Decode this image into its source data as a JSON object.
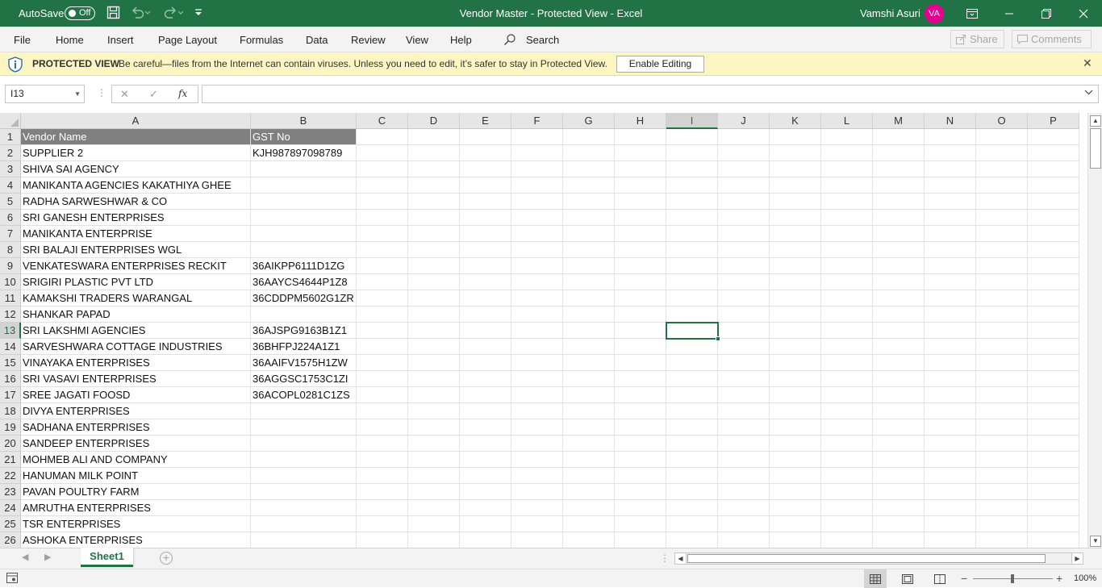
{
  "titlebar": {
    "autosave_label": "AutoSave",
    "autosave_state": "Off",
    "doc_title": "Vendor Master  -  Protected View  -  Excel",
    "user_name": "Vamshi Asuri",
    "user_initials": "VA",
    "colors": {
      "bar": "#217346",
      "avatar": "#e3008c"
    }
  },
  "menu": {
    "items": [
      "File",
      "Home",
      "Insert",
      "Page Layout",
      "Formulas",
      "Data",
      "Review",
      "View",
      "Help"
    ],
    "search_label": "Search",
    "share_label": "Share",
    "comments_label": "Comments"
  },
  "protected_view": {
    "title": "PROTECTED VIEW",
    "message": "Be careful—files from the Internet can contain viruses. Unless you need to edit, it’s safer to stay in Protected View.",
    "enable_button": "Enable Editing",
    "close_glyph": "✕",
    "colors": {
      "bar": "#fdf6c3"
    }
  },
  "formula_bar": {
    "name_box": "I13",
    "cancel_glyph": "✕",
    "enter_glyph": "✓",
    "fx_label": "fx",
    "formula": ""
  },
  "sheet": {
    "columns": [
      "A",
      "B",
      "C",
      "D",
      "E",
      "F",
      "G",
      "H",
      "I",
      "J",
      "K",
      "L",
      "M",
      "N",
      "O",
      "P"
    ],
    "selected_column": "I",
    "selected_row": 13,
    "active_cell": "I13",
    "rows": [
      {
        "n": "1",
        "a": "Vendor Name",
        "b": "GST No"
      },
      {
        "n": "2",
        "a": "SUPPLIER 2",
        "b": "KJH987897098789"
      },
      {
        "n": "3",
        "a": "SHIVA SAI AGENCY",
        "b": ""
      },
      {
        "n": "4",
        "a": "MANIKANTA AGENCIES KAKATHIYA GHEE",
        "b": ""
      },
      {
        "n": "5",
        "a": "RADHA SARWESHWAR & CO",
        "b": ""
      },
      {
        "n": "6",
        "a": "SRI GANESH ENTERPRISES",
        "b": ""
      },
      {
        "n": "7",
        "a": "MANIKANTA ENTERPRISE",
        "b": ""
      },
      {
        "n": "8",
        "a": "SRI BALAJI ENTERPRISES WGL",
        "b": ""
      },
      {
        "n": "9",
        "a": "VENKATESWARA ENTERPRISES RECKIT",
        "b": "36AIKPP6111D1ZG"
      },
      {
        "n": "10",
        "a": "SRIGIRI PLASTIC PVT LTD",
        "b": "36AAYCS4644P1Z8"
      },
      {
        "n": "11",
        "a": "KAMAKSHI TRADERS WARANGAL",
        "b": "36CDDPM5602G1ZR"
      },
      {
        "n": "12",
        "a": "SHANKAR PAPAD",
        "b": ""
      },
      {
        "n": "13",
        "a": "SRI LAKSHMI AGENCIES",
        "b": "36AJSPG9163B1Z1"
      },
      {
        "n": "14",
        "a": "SARVESHWARA COTTAGE INDUSTRIES",
        "b": "36BHFPJ224A1Z1"
      },
      {
        "n": "15",
        "a": "VINAYAKA ENTERPRISES",
        "b": "36AAIFV1575H1ZW"
      },
      {
        "n": "16",
        "a": "SRI VASAVI ENTERPRISES",
        "b": "36AGGSC1753C1ZI"
      },
      {
        "n": "17",
        "a": "SREE JAGATI FOOSD",
        "b": "36ACOPL0281C1ZS"
      },
      {
        "n": "18",
        "a": "DIVYA ENTERPRISES",
        "b": ""
      },
      {
        "n": "19",
        "a": "SADHANA ENTERPRISES",
        "b": ""
      },
      {
        "n": "20",
        "a": "SANDEEP ENTERPRISES",
        "b": ""
      },
      {
        "n": "21",
        "a": "MOHMEB ALI AND COMPANY",
        "b": ""
      },
      {
        "n": "22",
        "a": "HANUMAN MILK POINT",
        "b": ""
      },
      {
        "n": "23",
        "a": "PAVAN POULTRY FARM",
        "b": ""
      },
      {
        "n": "24",
        "a": "AMRUTHA ENTERPRISES",
        "b": ""
      },
      {
        "n": "25",
        "a": "TSR ENTERPRISES",
        "b": ""
      },
      {
        "n": "26",
        "a": "ASHOKA ENTERPRISES",
        "b": ""
      }
    ],
    "colors": {
      "header_row_fill": "#808080",
      "selection": "#217346"
    }
  },
  "tabs": {
    "sheet_name": "Sheet1",
    "add_glyph": "+"
  },
  "status": {
    "zoom_level": "100%",
    "zoom_minus": "−",
    "zoom_plus": "+"
  }
}
